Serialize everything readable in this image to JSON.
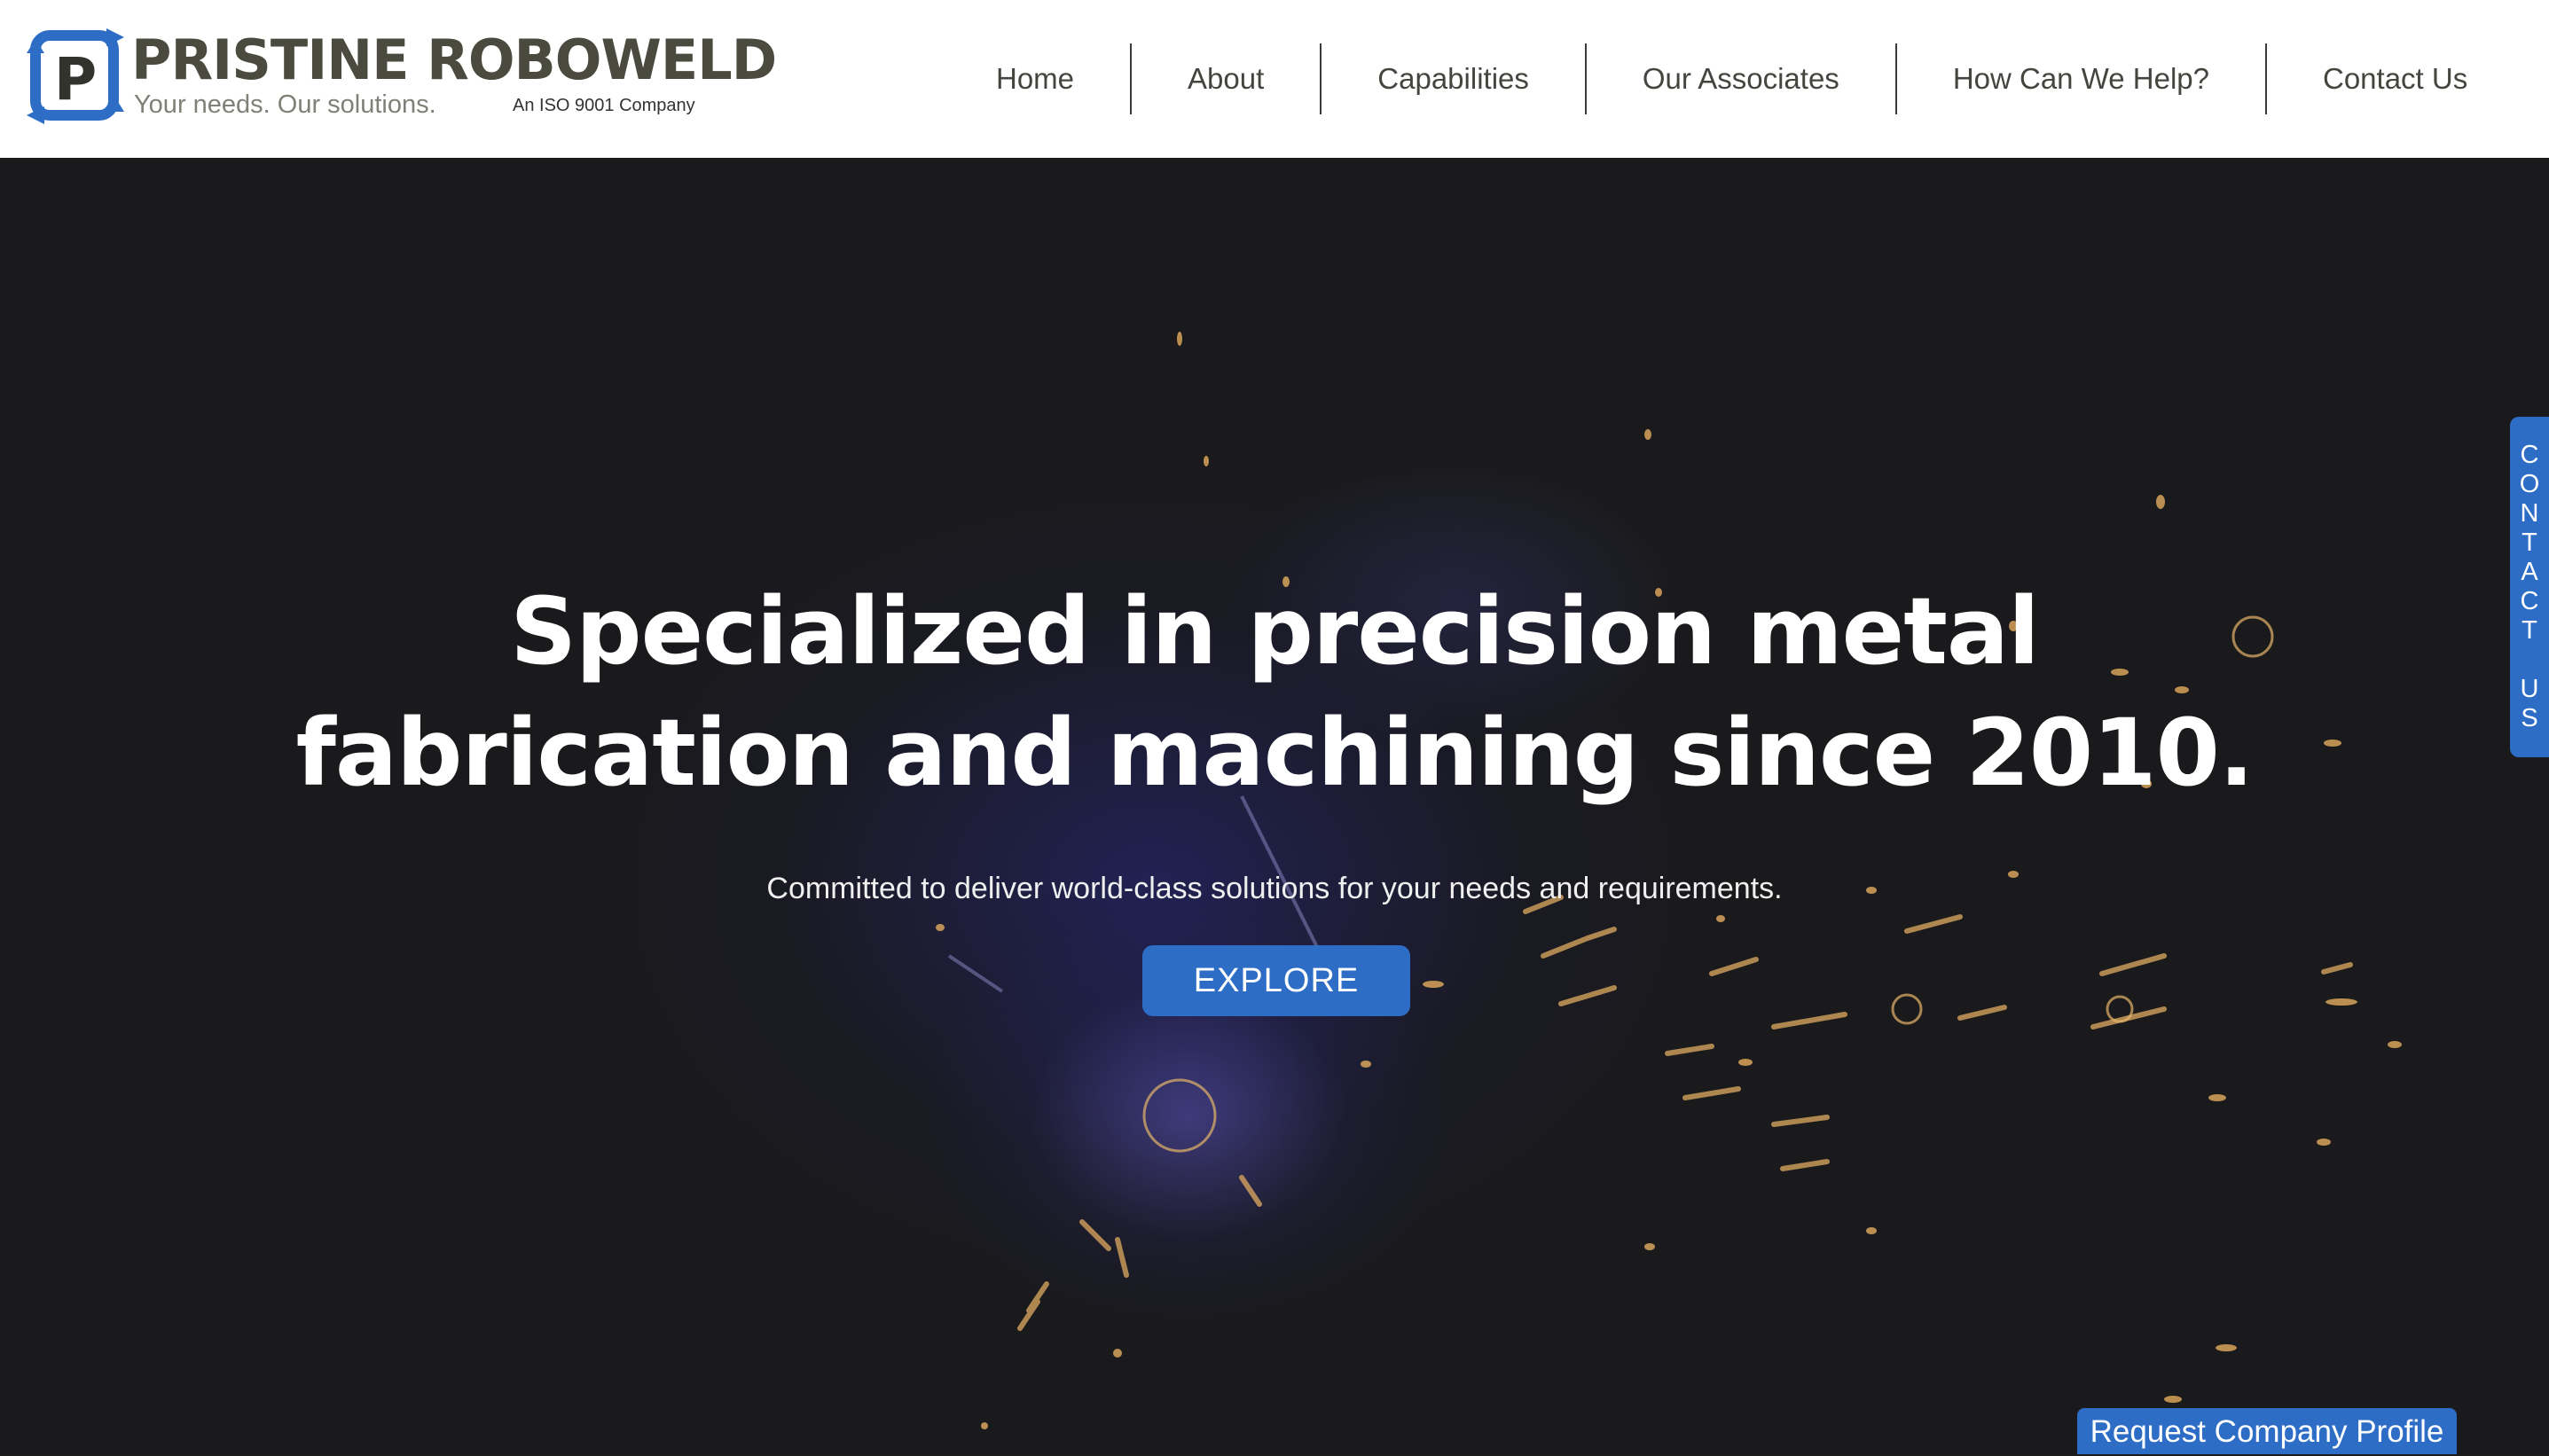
{
  "brand": {
    "name": "PRISTINE ROBOWELD",
    "tagline": "Your needs. Our solutions.",
    "iso": "An ISO 9001 Company",
    "logo_letter": "P",
    "colors": {
      "primary": "#2e6dc6",
      "text": "#4a4a3f"
    }
  },
  "nav": {
    "items": [
      {
        "label": "Home"
      },
      {
        "label": "About"
      },
      {
        "label": "Capabilities"
      },
      {
        "label": "Our Associates"
      },
      {
        "label": "How Can We Help?"
      },
      {
        "label": "Contact Us"
      }
    ]
  },
  "hero": {
    "title_line1": "Specialized in precision metal",
    "title_line2": "fabrication and machining since 2010.",
    "subtitle": "Committed to deliver world-class solutions for your needs and requirements.",
    "cta_label": "EXPLORE",
    "background": "welding-sparks-image"
  },
  "side_tab": {
    "label": "CONTACT US",
    "letters": [
      "C",
      "O",
      "N",
      "T",
      "A",
      "C",
      "T",
      " ",
      "U",
      "S"
    ]
  },
  "request_profile": {
    "label": "Request Company Profile"
  }
}
